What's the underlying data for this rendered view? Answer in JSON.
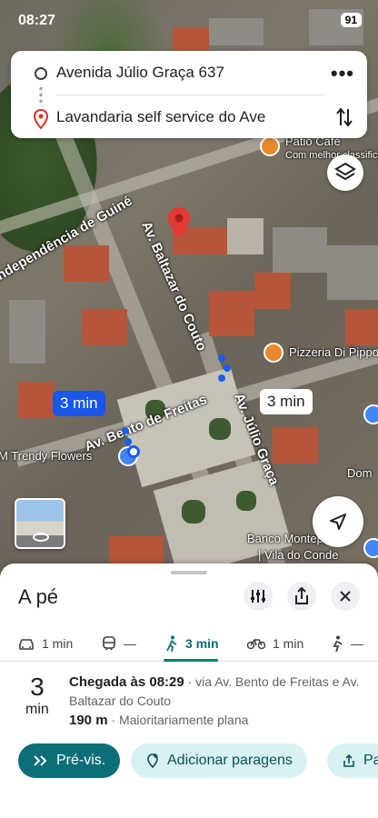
{
  "status_bar": {
    "time": "08:27",
    "battery": "91"
  },
  "search": {
    "origin": "Avenida Júlio Graça 637",
    "destination": "Lavandaria self service do Ave"
  },
  "map": {
    "streets": [
      "Av. Baltazar do Couto",
      "Independência de Guiné",
      "Av. Bento de Freitas",
      "Av. Júlio Graça"
    ],
    "pois": [
      "Pátio Café",
      "Com melhor classificação",
      "Pizzeria Di Pippo",
      "M Trendy Flowers",
      "Banco Montepio",
      "| Vila do Conde",
      "Dom"
    ],
    "route_badges": [
      "3 min",
      "3 min"
    ]
  },
  "sheet": {
    "title": "A pé",
    "modes": [
      {
        "icon": "car-icon",
        "label": "1 min"
      },
      {
        "icon": "transit-icon",
        "label": "—"
      },
      {
        "icon": "walk-icon",
        "label": "3 min"
      },
      {
        "icon": "bike-icon",
        "label": "1 min"
      },
      {
        "icon": "rideshare-icon",
        "label": "—"
      }
    ],
    "eta_value": "3",
    "eta_unit": "min",
    "arrival": "Chegada às 08:29",
    "via": " · via Av. Bento de Freitas e Av. Baltazar do Couto",
    "distance": "190 m",
    "terrain": " · Maioritariamente plana",
    "actions": [
      "Pré-vis.",
      "Adicionar paragens",
      "Pa"
    ]
  },
  "colors": {
    "accent": "#0b6e78",
    "route": "#1a5cf0",
    "pin": "#e53935"
  }
}
